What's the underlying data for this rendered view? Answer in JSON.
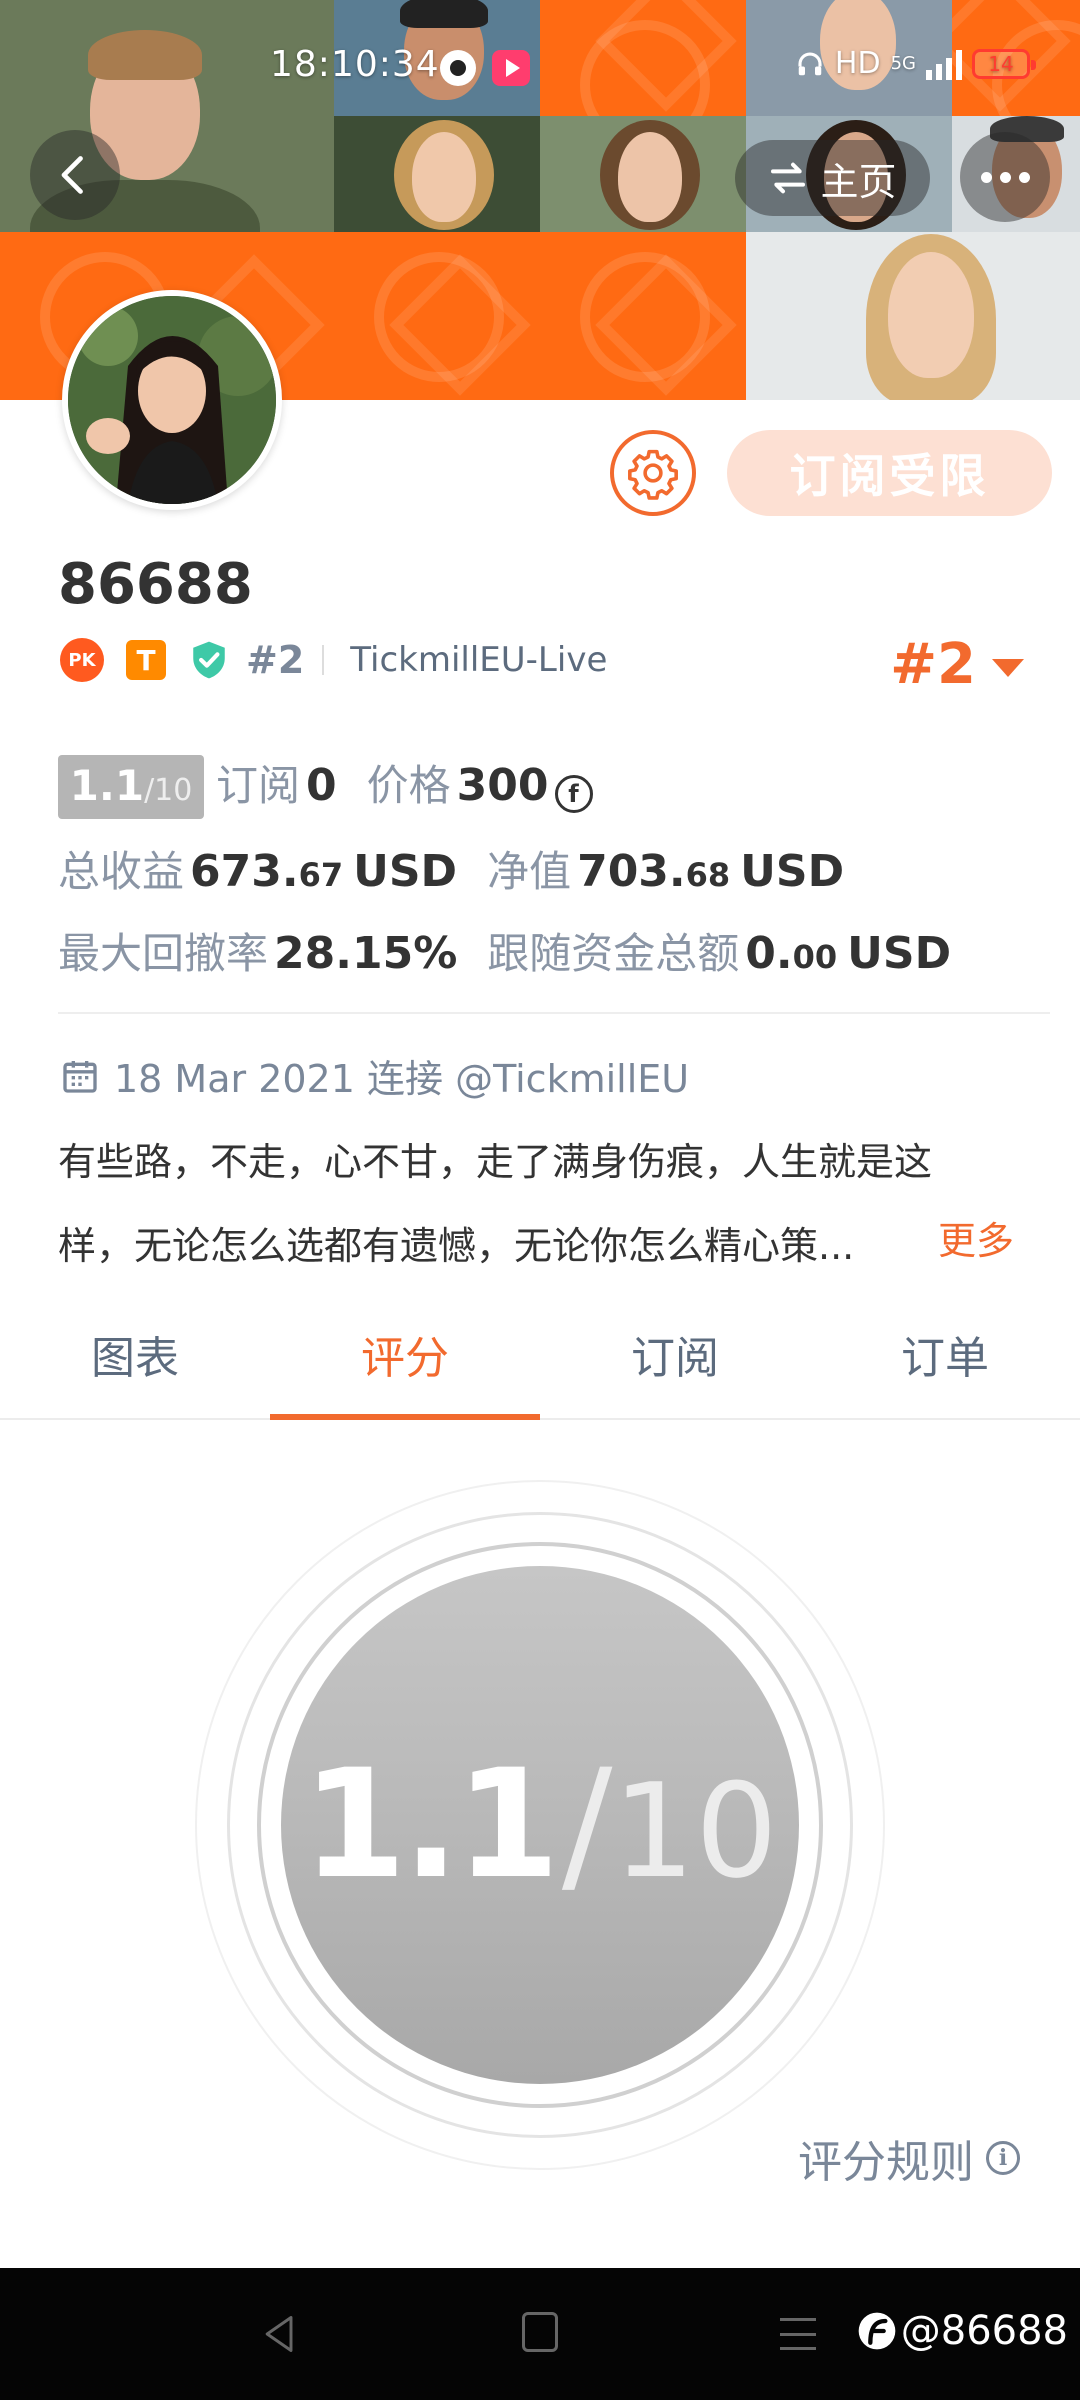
{
  "status_bar": {
    "time": "18:10:34",
    "hd_label": "HD",
    "network": "5G",
    "battery": "14"
  },
  "header": {
    "home_label": "主页"
  },
  "profile": {
    "username": "86688",
    "rank_inline": "#2",
    "broker": "TickmillEU-Live",
    "rank_right": "#2",
    "badge_t": "T",
    "badge_pk": "PK",
    "subscribe_label": "订阅受限"
  },
  "stats": {
    "score_whole": "1.1",
    "score_denominator": "/10",
    "subscriptions_label": "订阅",
    "subscriptions_value": "0",
    "price_label": "价格",
    "price_value": "300",
    "price_currency_symbol": "f",
    "total_profit_label": "总收益",
    "total_profit_int": "673.",
    "total_profit_dec": "67",
    "net_value_label": "净值",
    "net_value_int": "703.",
    "net_value_dec": "68",
    "currency": "USD",
    "max_drawdown_label": "最大回撤率",
    "max_drawdown_value": "28.15%",
    "follow_funds_label": "跟随资金总额",
    "follow_funds_int": "0.",
    "follow_funds_dec": "00"
  },
  "connection": {
    "text": "18 Mar 2021 连接 @TickmillEU"
  },
  "bio": {
    "line1": "有些路，不走，心不甘，走了满身伤痕，人生就是这",
    "line2": "样，无论怎么选都有遗憾，无论你怎么精心策...",
    "more_label": "更多"
  },
  "tabs": [
    {
      "label": "图表",
      "active": false
    },
    {
      "label": "评分",
      "active": true
    },
    {
      "label": "订阅",
      "active": false
    },
    {
      "label": "订单",
      "active": false
    }
  ],
  "dial": {
    "score": "1.1",
    "slash": "/",
    "denominator": "10"
  },
  "rules_label": "评分规则",
  "watermark": "@86688",
  "colors": {
    "accent": "#f26a2e",
    "banner_orange": "#ff6a13",
    "dial_gray": "#b8b8b8",
    "subscribe_disabled_bg": "#fde0d3"
  },
  "icons": {
    "back": "chevron-left-icon",
    "home_switch": "swap-arrows-icon",
    "more": "more-dots-icon",
    "settings": "gear-icon",
    "calendar": "calendar-icon",
    "info": "info-icon",
    "coin": "coin-icon",
    "shield": "shield-check-icon"
  }
}
